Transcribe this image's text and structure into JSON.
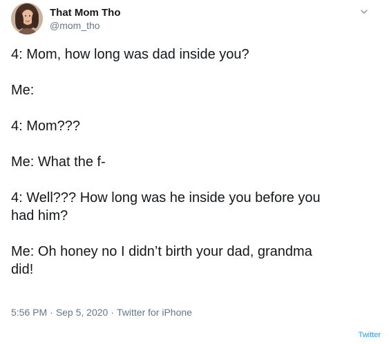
{
  "author": {
    "display_name": "That Mom Tho",
    "handle": "@mom_tho",
    "avatar": "profile-photo"
  },
  "header": {
    "menu_icon": "chevron-down-icon"
  },
  "tweet": {
    "lines": [
      "4: Mom, how long was dad inside you?",
      "Me:",
      "4: Mom???",
      "Me: What the f-",
      "4: Well??? How long was he inside you before you\nhad him?",
      "Me: Oh honey no I didn’t birth your dad, grandma\ndid!"
    ]
  },
  "meta": {
    "time": "5:56 PM",
    "date": "Sep 5, 2020",
    "separator": "·",
    "source": "Twitter for iPhone"
  },
  "footer": {
    "brand": "Twitter"
  },
  "colors": {
    "text": "#14171a",
    "secondary": "#657786",
    "accent": "#1da1f2"
  }
}
